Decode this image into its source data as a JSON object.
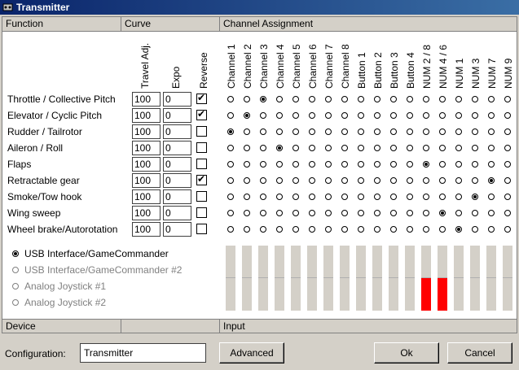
{
  "window": {
    "title": "Transmitter"
  },
  "headers": {
    "function": "Function",
    "curve": "Curve",
    "channel_assignment": "Channel Assignment",
    "device": "Device",
    "input": "Input"
  },
  "columns": {
    "travel_adj": "Travel Adj.",
    "expo": "Expo",
    "reverse": "Reverse"
  },
  "channels": [
    "Channel 1",
    "Channel 2",
    "Channel 3",
    "Channel 4",
    "Channel 5",
    "Channel 6",
    "Channel 7",
    "Channel 8",
    "Button 1",
    "Button 2",
    "Button 3",
    "Button 4",
    "NUM 2 / 8",
    "NUM 4 / 6",
    "NUM 1",
    "NUM 3",
    "NUM 7",
    "NUM 9"
  ],
  "functions": [
    {
      "label": "Throttle / Collective Pitch",
      "travel": "100",
      "expo": "0",
      "reverse": true,
      "channel": 3
    },
    {
      "label": "Elevator / Cyclic Pitch",
      "travel": "100",
      "expo": "0",
      "reverse": true,
      "channel": 2
    },
    {
      "label": "Rudder / Tailrotor",
      "travel": "100",
      "expo": "0",
      "reverse": false,
      "channel": 1
    },
    {
      "label": "Aileron / Roll",
      "travel": "100",
      "expo": "0",
      "reverse": false,
      "channel": 4
    },
    {
      "label": "Flaps",
      "travel": "100",
      "expo": "0",
      "reverse": false,
      "channel": 13
    },
    {
      "label": "Retractable gear",
      "travel": "100",
      "expo": "0",
      "reverse": true,
      "channel": 17
    },
    {
      "label": "Smoke/Tow hook",
      "travel": "100",
      "expo": "0",
      "reverse": false,
      "channel": 16
    },
    {
      "label": "Wing sweep",
      "travel": "100",
      "expo": "0",
      "reverse": false,
      "channel": 14
    },
    {
      "label": "Wheel brake/Autorotation",
      "travel": "100",
      "expo": "0",
      "reverse": false,
      "channel": 15
    }
  ],
  "devices": [
    {
      "label": "USB Interface/GameCommander",
      "selected": true,
      "enabled": true
    },
    {
      "label": "USB Interface/GameCommander #2",
      "selected": false,
      "enabled": false
    },
    {
      "label": "Analog Joystick #1",
      "selected": false,
      "enabled": false
    },
    {
      "label": "Analog Joystick #2",
      "selected": false,
      "enabled": false
    }
  ],
  "input_levels": [
    0,
    0,
    0,
    0,
    0,
    0,
    0,
    0,
    0,
    0,
    0,
    0,
    -0.5,
    -0.5,
    0,
    0,
    0,
    0
  ],
  "colors": {
    "level_fill": "#ff0000"
  },
  "bottom": {
    "config_label": "Configuration:",
    "config_value": "Transmitter",
    "advanced": "Advanced",
    "ok": "Ok",
    "cancel": "Cancel"
  }
}
